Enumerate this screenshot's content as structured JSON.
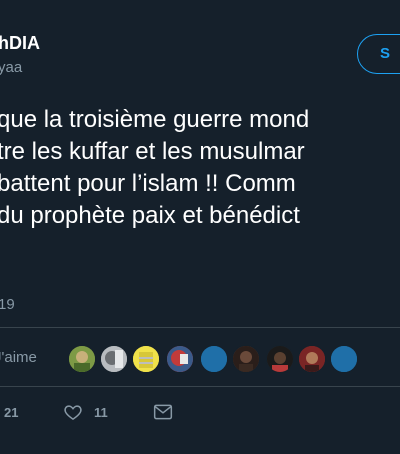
{
  "author": {
    "display_name": "hDIA",
    "handle": "yaa"
  },
  "follow_button": {
    "label": "S"
  },
  "tweet": {
    "lines": [
      "que la troisième guerre mond",
      "tre les kuffar et les musulmar",
      " battent pour l’islam !! Comm",
      " du prophète paix et bénédict"
    ],
    "timestamp": "19"
  },
  "likes_row": {
    "label": "J'aime",
    "avatars": [
      {
        "color": "#6a8a3a",
        "icon": "avatar-green"
      },
      {
        "color": "#9aa0a6",
        "icon": "avatar-gray"
      },
      {
        "color": "#e8d44a",
        "icon": "avatar-yellow"
      },
      {
        "color": "#c23b3b",
        "icon": "avatar-red"
      },
      {
        "color": "#1d6fa5",
        "icon": "avatar-default"
      },
      {
        "color": "#1d6fa5",
        "icon": "avatar-default"
      },
      {
        "color": "#5a3a2e",
        "icon": "avatar-dark"
      },
      {
        "color": "#2b2b2b",
        "icon": "avatar-dark"
      },
      {
        "color": "#4a3a33",
        "icon": "avatar-dark"
      },
      {
        "color": "#8a2a2a",
        "icon": "avatar-red-dark"
      },
      {
        "color": "#1d6fa5",
        "icon": "avatar-default"
      }
    ]
  },
  "actions": {
    "retweets": "21",
    "likes": "11",
    "share_icon": "mail-icon"
  },
  "colors": {
    "background": "#15202b",
    "accent": "#1da1f2",
    "muted": "#8899a6",
    "divider": "#38444d"
  }
}
